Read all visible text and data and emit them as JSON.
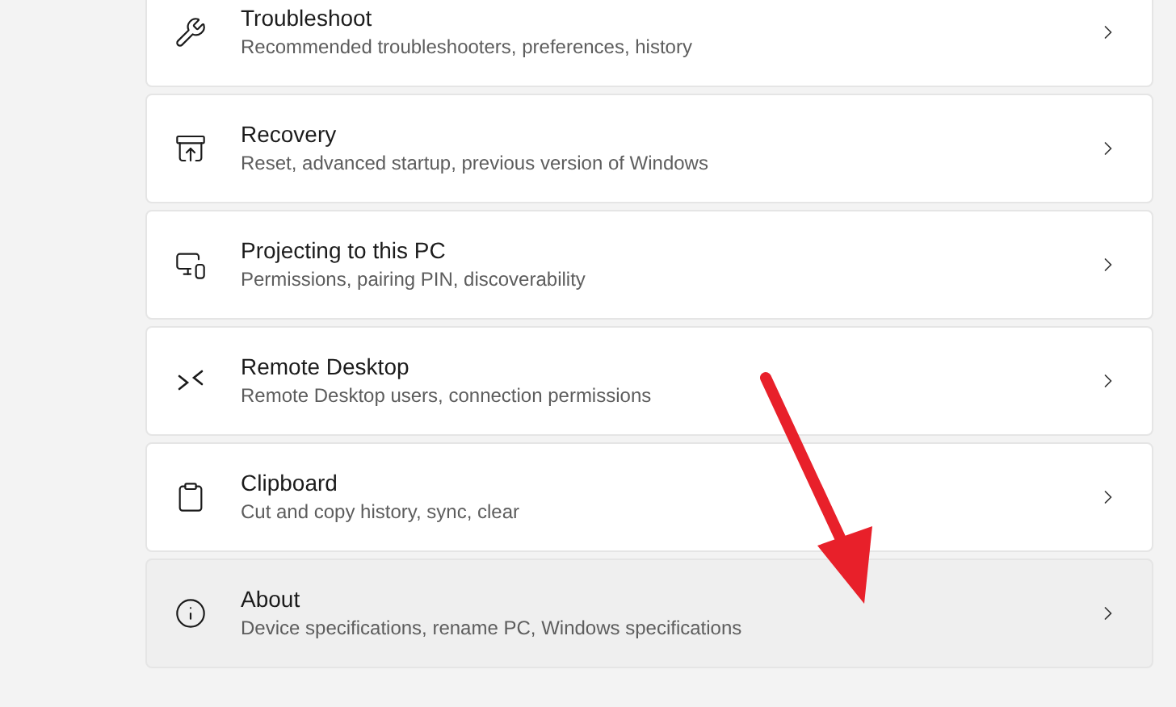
{
  "items": [
    {
      "title": "Troubleshoot",
      "subtitle": "Recommended troubleshooters, preferences, history",
      "hovered": false
    },
    {
      "title": "Recovery",
      "subtitle": "Reset, advanced startup, previous version of Windows",
      "hovered": false
    },
    {
      "title": "Projecting to this PC",
      "subtitle": "Permissions, pairing PIN, discoverability",
      "hovered": false
    },
    {
      "title": "Remote Desktop",
      "subtitle": "Remote Desktop users, connection permissions",
      "hovered": false
    },
    {
      "title": "Clipboard",
      "subtitle": "Cut and copy history, sync, clear",
      "hovered": false
    },
    {
      "title": "About",
      "subtitle": "Device specifications, rename PC, Windows specifications",
      "hovered": true
    }
  ]
}
